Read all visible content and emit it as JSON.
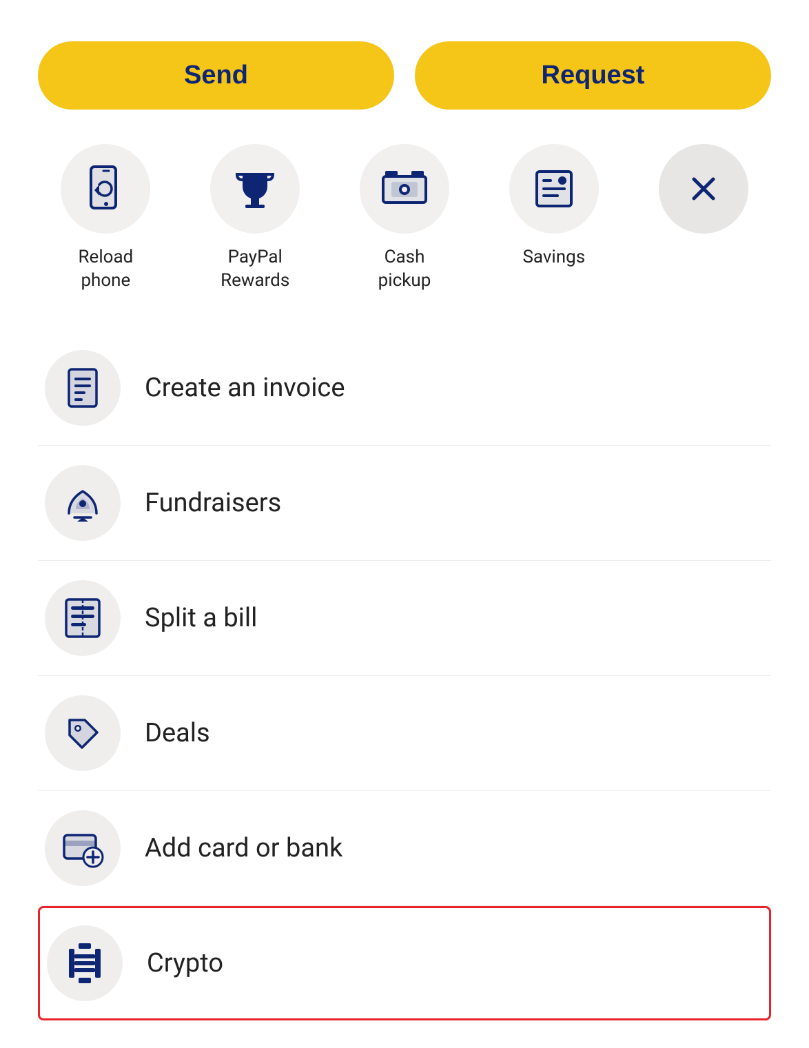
{
  "buttons": {
    "send_label": "Send",
    "request_label": "Request"
  },
  "quick_actions": [
    {
      "id": "reload-phone",
      "label": "Reload\nphone",
      "icon": "reload-phone-icon"
    },
    {
      "id": "paypal-rewards",
      "label": "PayPal\nRewards",
      "icon": "trophy-icon"
    },
    {
      "id": "cash-pickup",
      "label": "Cash\npickup",
      "icon": "cash-pickup-icon"
    },
    {
      "id": "savings",
      "label": "Savings",
      "icon": "savings-icon"
    },
    {
      "id": "close",
      "label": "",
      "icon": "close-icon"
    }
  ],
  "menu_items": [
    {
      "id": "create-invoice",
      "label": "Create an invoice",
      "icon": "invoice-icon"
    },
    {
      "id": "fundraisers",
      "label": "Fundraisers",
      "icon": "fundraisers-icon"
    },
    {
      "id": "split-bill",
      "label": "Split a bill",
      "icon": "split-bill-icon"
    },
    {
      "id": "deals",
      "label": "Deals",
      "icon": "deals-icon"
    },
    {
      "id": "add-card-or-bank",
      "label": "Add card or bank",
      "icon": "add-card-icon"
    },
    {
      "id": "crypto",
      "label": "Crypto",
      "icon": "crypto-icon",
      "highlighted": true
    }
  ],
  "colors": {
    "brand_yellow": "#F5C518",
    "brand_navy": "#0d2573",
    "icon_bg": "#f0eeed",
    "highlight_red": "#e8232a"
  }
}
